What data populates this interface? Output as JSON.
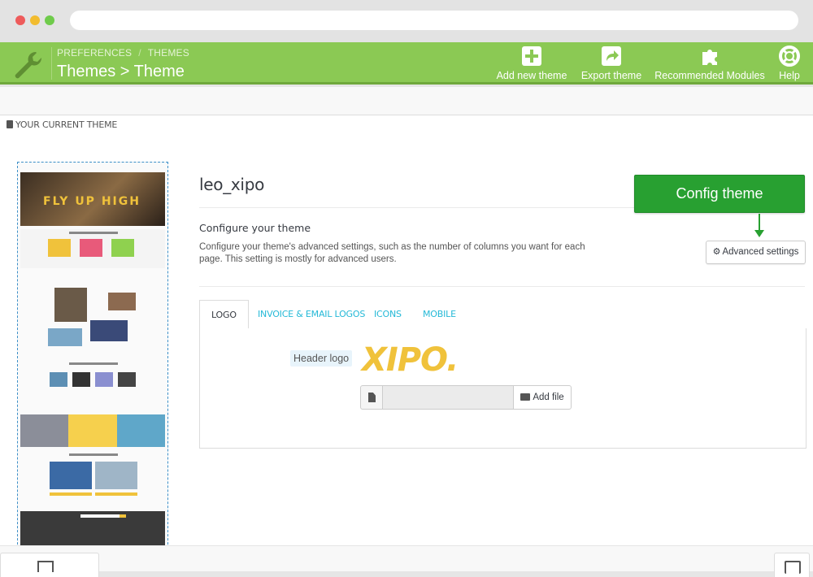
{
  "toolbar": {
    "breadcrumb_1": "PREFERENCES",
    "breadcrumb_sep": "/",
    "breadcrumb_2": "THEMES",
    "title": "Themes > Theme",
    "buttons": {
      "add_new_theme": "Add new theme",
      "export_theme": "Export theme",
      "recommended_modules": "Recommended Modules",
      "help": "Help"
    }
  },
  "panel": {
    "heading": "YOUR CURRENT THEME"
  },
  "preview": {
    "hero_text": "FLY UP HIGH"
  },
  "theme": {
    "name": "leo_xipo",
    "configure_title": "Configure your theme",
    "configure_desc": "Configure your theme's advanced settings, such as the number of columns you want for each page. This setting is mostly for advanced users.",
    "advanced_settings_label": "Advanced settings"
  },
  "callout": {
    "label": "Config theme"
  },
  "tabs": [
    {
      "label": "LOGO",
      "active": true
    },
    {
      "label": "INVOICE & EMAIL LOGOS",
      "active": false
    },
    {
      "label": "ICONS",
      "active": false
    },
    {
      "label": "MOBILE",
      "active": false
    }
  ],
  "logo_form": {
    "header_logo_label": "Header logo",
    "logo_text": "XIPO.",
    "add_file_label": "Add file",
    "file_value": ""
  },
  "colors": {
    "toolbar_green": "#8bc954",
    "callout_green": "#28a031",
    "link_blue": "#25b9d7",
    "logo_yellow": "#f0c23b"
  },
  "icons": {
    "wrench": "wrench-icon",
    "add": "plus-square-icon",
    "export": "share-icon",
    "modules": "puzzle-icon",
    "help": "lifebuoy-icon",
    "gear": "gear-icon",
    "file": "file-icon",
    "folder": "folder-open-icon",
    "save": "save-icon"
  }
}
